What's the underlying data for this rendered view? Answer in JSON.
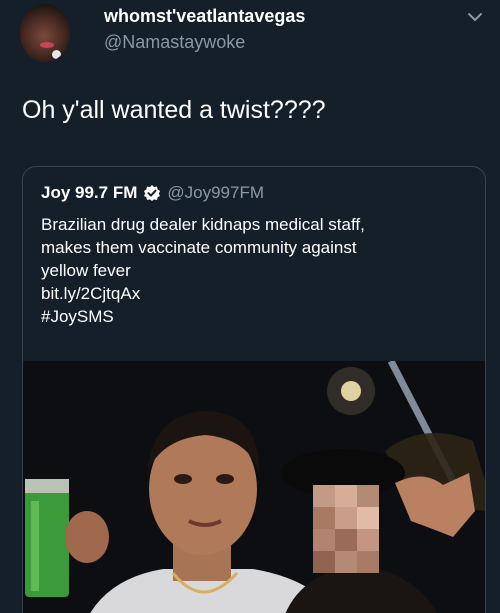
{
  "author": {
    "display_name": "whomst'veatlantavegas",
    "handle": "@Namastaywoke"
  },
  "tweet": {
    "text": "Oh y'all wanted a twist????"
  },
  "quoted": {
    "display_name": "Joy 99.7 FM",
    "handle": "@Joy997FM",
    "lines": [
      "Brazilian drug dealer kidnaps medical staff,",
      "makes them vaccinate community against",
      "yellow fever",
      "bit.ly/2CjtqAx",
      "#JoySMS"
    ]
  },
  "icons": {
    "menu": "chevron-down-icon",
    "verified": "verified-badge-icon"
  },
  "colors": {
    "background": "#151f2a",
    "secondary_text": "#8899a6",
    "card_border": "#38444d"
  }
}
